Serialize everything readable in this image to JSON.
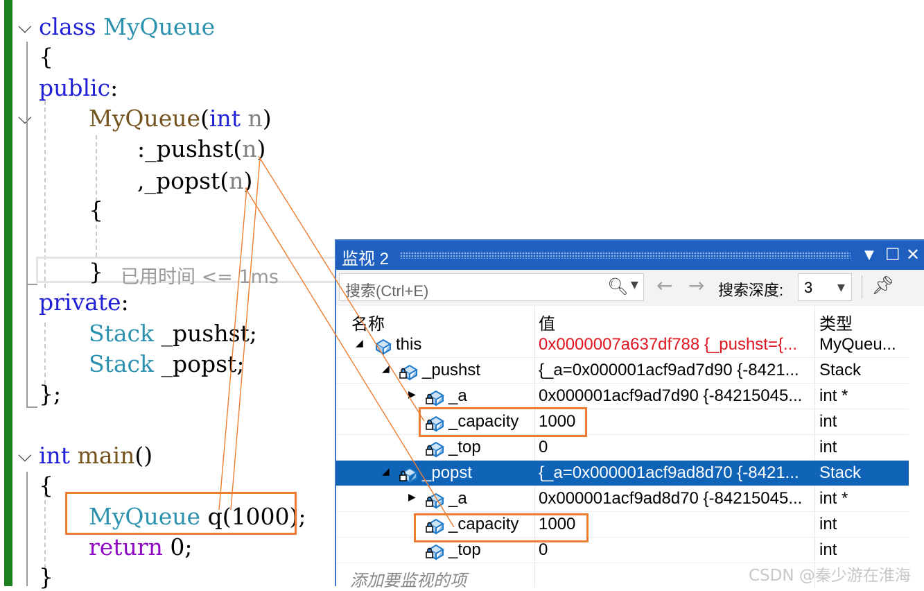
{
  "editor": {
    "line_class": [
      "class",
      "MyQueue"
    ],
    "brace_open": "{",
    "public": "public",
    "ctor_name": "MyQueue",
    "ctor_param_type": "int",
    "ctor_param": "n",
    "init1_name": ":_pushst",
    "init2_name": ",_popst",
    "elapsed": "已用时间 <= 1ms",
    "private": "private",
    "member_type": "Stack",
    "member1": "_pushst;",
    "member2": "_popst;",
    "brace_close_semi": "};",
    "main_ret": "int",
    "main_name": "main",
    "main_parens": "()",
    "decl_type": "MyQueue",
    "decl_var": "q",
    "decl_arg": "1000",
    "return_kw": "return",
    "return_val": "0;"
  },
  "watch": {
    "title": "监视 2",
    "search_placeholder": "搜索(Ctrl+E)",
    "depth_label": "搜索深度:",
    "depth_value": "3",
    "columns": [
      "名称",
      "值",
      "类型"
    ],
    "rows": [
      {
        "name": "this",
        "value": "0x0000007a637df788 {_pushst={...",
        "type": "MyQueu...",
        "level": 0,
        "expander": "expanded",
        "red": true
      },
      {
        "name": "_pushst",
        "value": "{_a=0x000001acf9ad7d90 {-8421...",
        "type": "Stack",
        "level": 1,
        "expander": "expanded"
      },
      {
        "name": "_a",
        "value": "0x000001acf9ad7d90 {-84215045...",
        "type": "int *",
        "level": 2,
        "expander": "collapsed"
      },
      {
        "name": "_capacity",
        "value": "1000",
        "type": "int",
        "level": 2,
        "expander": "none"
      },
      {
        "name": "_top",
        "value": "0",
        "type": "int",
        "level": 2,
        "expander": "none"
      },
      {
        "name": "_popst",
        "value": "{_a=0x000001acf9ad8d70 {-8421...",
        "type": "Stack",
        "level": 1,
        "expander": "expanded",
        "selected": true
      },
      {
        "name": "_a",
        "value": "0x000001acf9ad8d70 {-84215045...",
        "type": "int *",
        "level": 2,
        "expander": "collapsed"
      },
      {
        "name": "_capacity",
        "value": "1000",
        "type": "int",
        "level": 2,
        "expander": "none"
      },
      {
        "name": "_top",
        "value": "0",
        "type": "int",
        "level": 2,
        "expander": "none"
      }
    ],
    "add_item": "添加要监视的项"
  },
  "watermark": "CSDN @秦少游在淮海",
  "colors": {
    "accent": "#1f5fbf",
    "highlight": "#ed7d31",
    "selection": "#0f64b8",
    "gutter": "#1e7f1e"
  }
}
